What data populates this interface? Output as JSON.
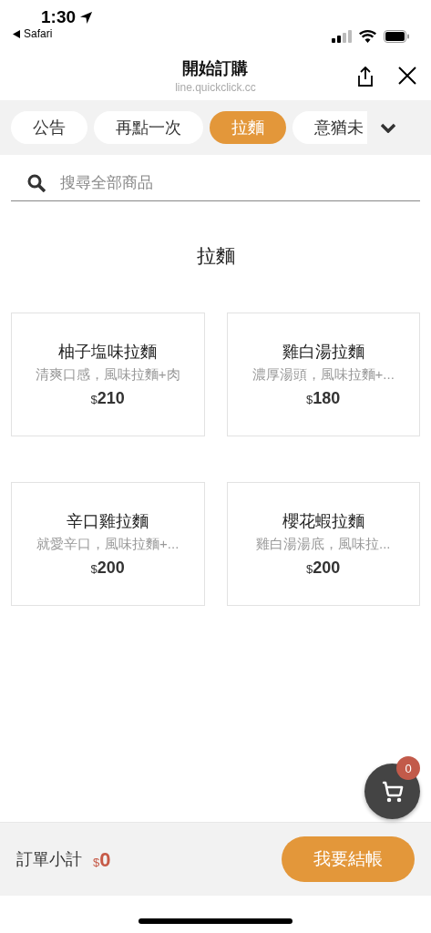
{
  "status_bar": {
    "time": "1:30",
    "back_app": "Safari"
  },
  "header": {
    "title": "開始訂購",
    "url": "line.quickclick.cc"
  },
  "tabs": [
    {
      "label": "公告",
      "selected": false
    },
    {
      "label": "再點一次",
      "selected": false
    },
    {
      "label": "拉麵",
      "selected": true
    },
    {
      "label": "意猶未",
      "selected": false
    }
  ],
  "search": {
    "placeholder": "搜尋全部商品"
  },
  "section_title": "拉麵",
  "products": [
    {
      "name": "柚子塩味拉麵",
      "description": "清爽口感，風味拉麵+肉",
      "currency": "$",
      "amount": "210"
    },
    {
      "name": "雞白湯拉麵",
      "description": "濃厚湯頭，風味拉麵+...",
      "currency": "$",
      "amount": "180"
    },
    {
      "name": "辛口雞拉麵",
      "description": "就愛辛口，風味拉麵+...",
      "currency": "$",
      "amount": "200"
    },
    {
      "name": "櫻花蝦拉麵",
      "description": "雞白湯湯底，風味拉...",
      "currency": "$",
      "amount": "200"
    }
  ],
  "cart": {
    "count": "0"
  },
  "footer": {
    "subtotal_label": "訂單小計",
    "currency": "$",
    "amount": "0",
    "checkout": "我要結帳"
  }
}
